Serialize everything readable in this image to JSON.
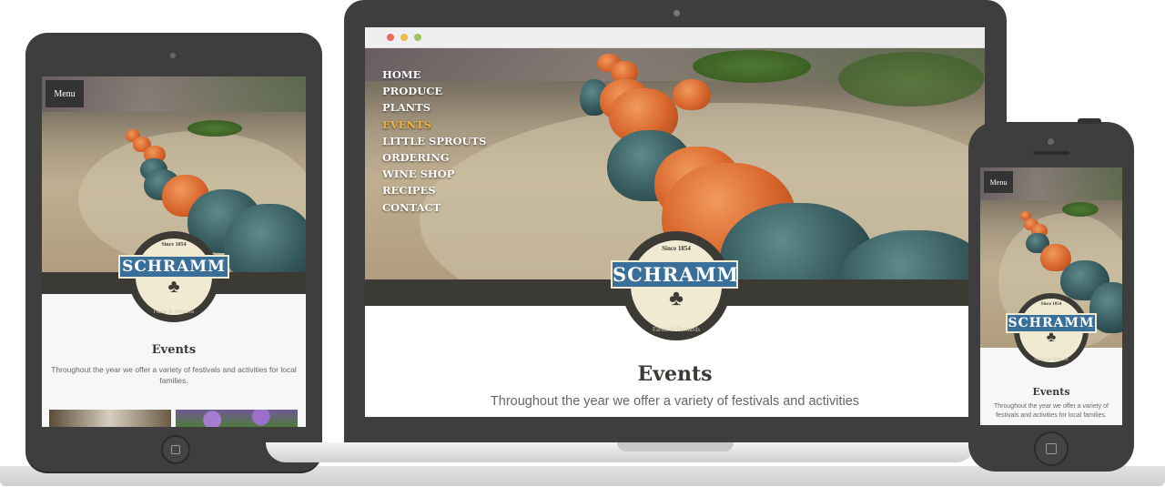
{
  "brand": {
    "name": "SCHRAMM",
    "since": "Since 1854",
    "tagline": "Farms & Orchards",
    "ribbon_color": "#3a6f99",
    "band_color": "#3b3a35"
  },
  "menu_button": {
    "label": "Menu",
    "icon": "menu-button"
  },
  "nav": {
    "items": [
      "HOME",
      "PRODUCE",
      "PLANTS",
      "EVENTS",
      "LITTLE SPROUTS",
      "ORDERING",
      "WINE SHOP",
      "RECIPES",
      "CONTACT"
    ],
    "active": "EVENTS",
    "active_color": "#f2b233"
  },
  "laptop": {
    "title": "Events",
    "text": "Throughout the year we offer a variety of festivals and activities",
    "window_dots": [
      "#e96c5a",
      "#f0b94b",
      "#9dc35b"
    ]
  },
  "tablet": {
    "title": "Events",
    "text": "Throughout the year we offer a variety of festivals and activities for local families."
  },
  "phone": {
    "title": "Events",
    "text": "Throughout the year we offer a variety of festivals and activities for local families."
  }
}
